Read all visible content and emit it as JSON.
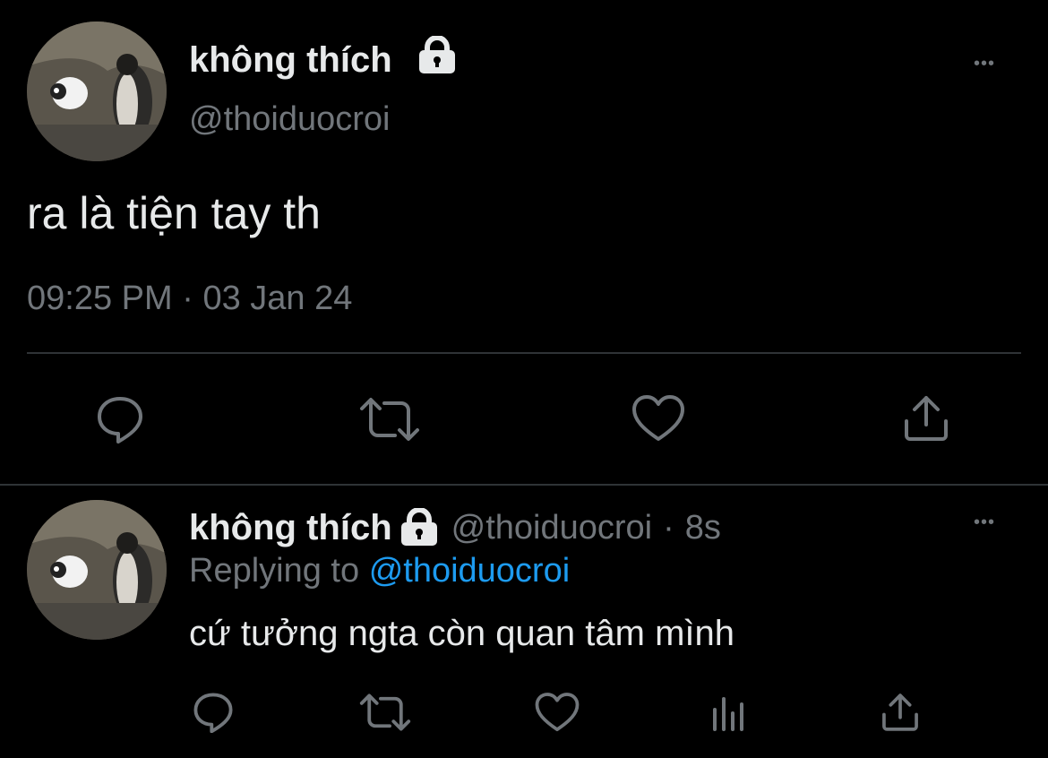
{
  "main_tweet": {
    "display_name": "không thích",
    "handle": "@thoiduocroi",
    "text": "ra là tiện tay th",
    "time": "09:25 PM",
    "separator": "·",
    "date": "03 Jan 24",
    "more": "•••"
  },
  "reply_tweet": {
    "display_name": "không thích",
    "handle": "@thoiduocroi",
    "separator": "·",
    "age": "8s",
    "replying_prefix": "Replying to",
    "replying_handle": "@thoiduocroi",
    "text": "cứ tưởng ngta còn quan tâm mình",
    "more": "•••"
  },
  "icons": {
    "reply": "reply-icon",
    "retweet": "retweet-icon",
    "like": "heart-icon",
    "share": "share-icon",
    "analytics": "analytics-icon",
    "lock": "lock-icon"
  },
  "colors": {
    "background": "#000000",
    "text": "#e7e9ea",
    "muted": "#71767b",
    "link": "#1d9bf0",
    "divider": "#2f3336"
  }
}
